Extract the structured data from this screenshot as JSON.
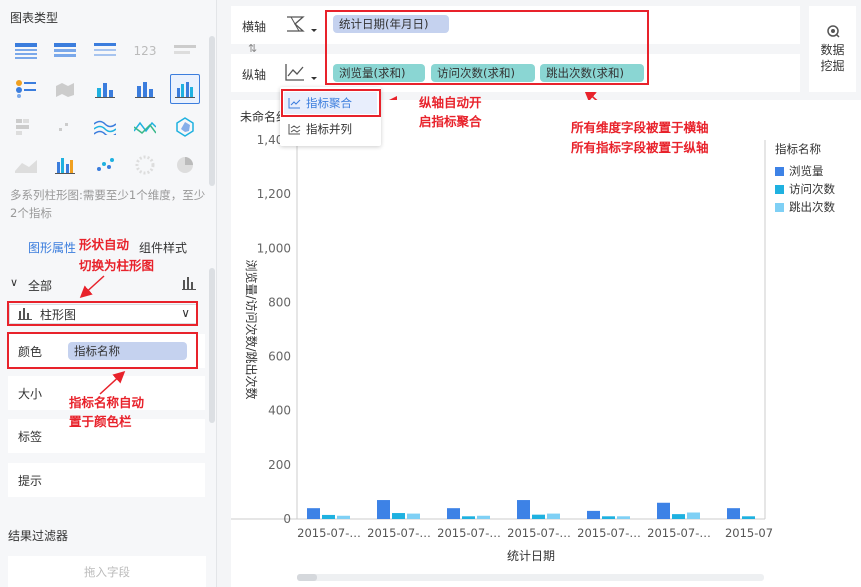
{
  "left_panel": {
    "chart_type_title": "图表类型",
    "chart_type_desc": "多系列柱形图:需要至少1个维度，至少2个指标",
    "tabs": [
      "图形属性",
      "组件样式"
    ],
    "section_all": "全部",
    "shape_select": "柱形图",
    "props": [
      {
        "label": "颜色",
        "value": "指标名称"
      },
      {
        "label": "大小"
      },
      {
        "label": "标签"
      },
      {
        "label": "提示"
      }
    ],
    "filter_title": "结果过滤器",
    "filter_placeholder": "拖入字段"
  },
  "axes": {
    "x_label": "横轴",
    "y_label": "纵轴",
    "x_fields": [
      "统计日期(年月日)"
    ],
    "y_fields": [
      "浏览量(求和)",
      "访问次数(求和)",
      "跳出次数(求和)"
    ]
  },
  "data_mining": {
    "line1": "数据",
    "line2": "挖掘"
  },
  "chart_title": "未命名组件",
  "popup": {
    "items": [
      "指标聚合",
      "指标并列"
    ]
  },
  "legend": {
    "title": "指标名称",
    "items": [
      {
        "name": "浏览量",
        "color": "#3d82e6"
      },
      {
        "name": "访问次数",
        "color": "#1fb1e0"
      },
      {
        "name": "跳出次数",
        "color": "#7fd0f5"
      }
    ]
  },
  "annotations": {
    "shape_auto": "形状自动",
    "shape_auto_2": "切换为柱形图",
    "color_auto": "指标名称自动",
    "color_auto_2": "置于颜色栏",
    "yaxis_auto": "纵轴自动开",
    "yaxis_auto_2": "启指标聚合",
    "dims_auto": "所有维度字段被置于横轴",
    "metrics_auto": "所有指标字段被置于纵轴"
  },
  "chart_data": {
    "type": "bar",
    "categories": [
      "2015-07-…",
      "2015-07-…",
      "2015-07-…",
      "2015-07-…",
      "2015-07-…",
      "2015-07-…",
      "2015-07"
    ],
    "series": [
      {
        "name": "浏览量",
        "values": [
          40,
          70,
          40,
          70,
          30,
          60,
          40
        ]
      },
      {
        "name": "访问次数",
        "values": [
          15,
          22,
          10,
          16,
          10,
          18,
          10
        ]
      },
      {
        "name": "跳出次数",
        "values": [
          12,
          20,
          12,
          20,
          10,
          24,
          0
        ]
      }
    ],
    "xlabel": "统计日期",
    "ylabel": "浏览量/访问次数/跳出次数",
    "ylim": [
      0,
      1400
    ],
    "yticks": [
      "1,400",
      "1,200",
      "1,000",
      "800",
      "600",
      "400",
      "200",
      "0"
    ],
    "legend_position": "right"
  }
}
